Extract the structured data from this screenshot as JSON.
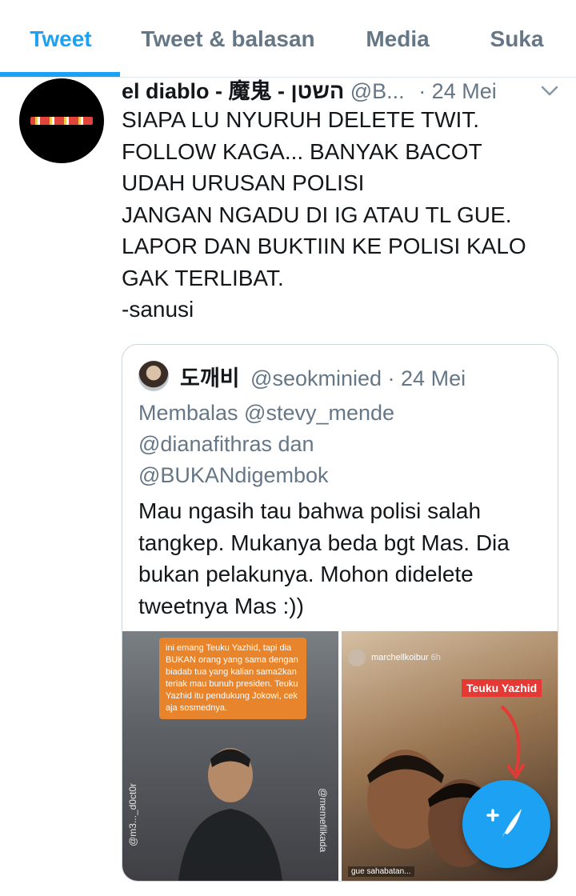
{
  "tabs": [
    {
      "label": "Tweet",
      "active": true
    },
    {
      "label": "Tweet & balasan",
      "active": false
    },
    {
      "label": "Media",
      "active": false
    },
    {
      "label": "Suka",
      "active": false
    }
  ],
  "tweet": {
    "name": "el diablo - 魔鬼 - השטן",
    "handle": "@B...",
    "date": "· 24 Mei",
    "lines": [
      "SIAPA LU NYURUH DELETE TWIT.",
      "FOLLOW KAGA... BANYAK BACOT",
      "UDAH URUSAN POLISI",
      "JANGAN NGADU DI IG ATAU TL GUE.",
      "LAPOR DAN BUKTIIN KE POLISI KALO",
      "GAK TERLIBAT.",
      "-sanusi"
    ]
  },
  "quote": {
    "name": "도깨비",
    "handle": "@seokminied",
    "date": "· 24 Mei",
    "reply_lines": [
      "Membalas @stevy_mende",
      "@dianafithras dan",
      "@BUKANdigembok"
    ],
    "text_lines": [
      "Mau ngasih tau bahwa polisi salah",
      "tangkep. Mukanya beda bgt Mas. Dia",
      "bukan pelakunya. Mohon didelete",
      "tweetnya Mas :))"
    ],
    "media_left": {
      "caption": "ini emang Teuku Yazhid, tapi dia BUKAN orang yang sama dengan biadab tua yang kalian sama2kan teriak mau bunuh presiden. Teuku Yazhid itu pendukung Jokowi, cek aja sosmednya.",
      "watermark_left": "@m3..._d0ct0r",
      "watermark_right": "@memefilkada"
    },
    "media_right": {
      "story_user": "marchellkoibur",
      "story_time": "6h",
      "label": "Teuku Yazhid",
      "caption": "gue sahabatan..."
    }
  },
  "colors": {
    "accent": "#1da1f2",
    "secondary_text": "#657786",
    "label_red": "#e53935",
    "caption_orange": "#e8842c"
  },
  "fab": {
    "icon": "compose-tweet-icon"
  }
}
